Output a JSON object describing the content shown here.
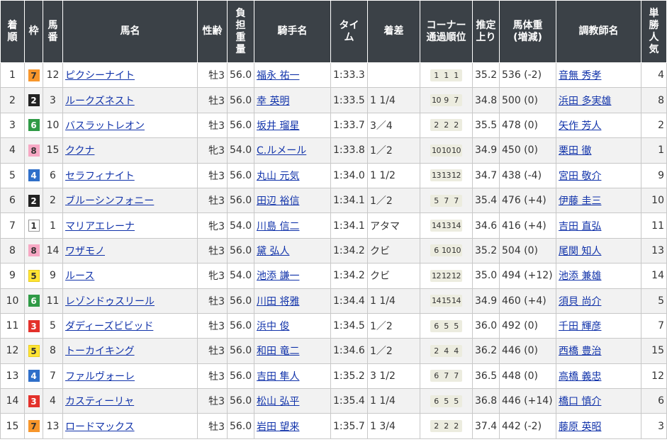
{
  "headers": {
    "rank": "着順",
    "waku": "枠",
    "umaban": "馬番",
    "horse": "馬名",
    "sexage": "性齢",
    "weight": "負担重量",
    "jockey": "騎手名",
    "time": "タイム",
    "margin": "着差",
    "corner": "コーナー通過順位",
    "last": "推定上り",
    "bodyweight": "馬体重(増減)",
    "trainer": "調教師名",
    "pop": "単勝人気"
  },
  "waku_colors": {
    "1": {
      "bg": "#ffffff",
      "fg": "#333333",
      "border": "#999999"
    },
    "2": {
      "bg": "#222222",
      "fg": "#ffffff",
      "border": "#222222"
    },
    "3": {
      "bg": "#e3312b",
      "fg": "#ffffff",
      "border": "#e3312b"
    },
    "4": {
      "bg": "#2f6fc9",
      "fg": "#ffffff",
      "border": "#2f6fc9"
    },
    "5": {
      "bg": "#ffe433",
      "fg": "#333333",
      "border": "#e8cc20"
    },
    "6": {
      "bg": "#2f9a46",
      "fg": "#ffffff",
      "border": "#2f9a46"
    },
    "7": {
      "bg": "#f7962b",
      "fg": "#333333",
      "border": "#f7962b"
    },
    "8": {
      "bg": "#f7a8c4",
      "fg": "#333333",
      "border": "#f7a8c4"
    }
  },
  "rows": [
    {
      "rank": "1",
      "waku": "7",
      "umaban": "12",
      "horse": "ピクシーナイト",
      "sexage": "牡3",
      "weight": "56.0",
      "jockey": "福永 祐一",
      "time": "1:33.3",
      "margin": "",
      "corner": [
        "1",
        "1",
        "1"
      ],
      "last": "35.2",
      "bodyweight": "536 (-2)",
      "trainer": "音無 秀孝",
      "pop": "4"
    },
    {
      "rank": "2",
      "waku": "2",
      "umaban": "3",
      "horse": "ルークズネスト",
      "sexage": "牡3",
      "weight": "56.0",
      "jockey": "幸 英明",
      "time": "1:33.5",
      "margin": "1 1/4",
      "corner": [
        "10",
        "9",
        "7"
      ],
      "last": "34.8",
      "bodyweight": "500 (0)",
      "trainer": "浜田 多実雄",
      "pop": "8"
    },
    {
      "rank": "3",
      "waku": "6",
      "umaban": "10",
      "horse": "バスラットレオン",
      "sexage": "牡3",
      "weight": "56.0",
      "jockey": "坂井 瑠星",
      "time": "1:33.7",
      "margin": "3／4",
      "corner": [
        "2",
        "2",
        "2"
      ],
      "last": "35.5",
      "bodyweight": "478 (0)",
      "trainer": "矢作 芳人",
      "pop": "2"
    },
    {
      "rank": "4",
      "waku": "8",
      "umaban": "15",
      "horse": "ククナ",
      "sexage": "牝3",
      "weight": "54.0",
      "jockey": "C.ルメール",
      "time": "1:33.8",
      "margin": "1／2",
      "corner": [
        "10",
        "10",
        "10"
      ],
      "last": "34.9",
      "bodyweight": "450 (0)",
      "trainer": "栗田 徹",
      "pop": "1"
    },
    {
      "rank": "5",
      "waku": "4",
      "umaban": "6",
      "horse": "セラフィナイト",
      "sexage": "牡3",
      "weight": "56.0",
      "jockey": "丸山 元気",
      "time": "1:34.0",
      "margin": "1 1/2",
      "corner": [
        "13",
        "13",
        "12"
      ],
      "last": "34.7",
      "bodyweight": "438 (-4)",
      "trainer": "宮田 敬介",
      "pop": "9"
    },
    {
      "rank": "6",
      "waku": "2",
      "umaban": "2",
      "horse": "ブルーシンフォニー",
      "sexage": "牡3",
      "weight": "56.0",
      "jockey": "田辺 裕信",
      "time": "1:34.1",
      "margin": "1／2",
      "corner": [
        "5",
        "7",
        "7"
      ],
      "last": "35.4",
      "bodyweight": "476 (+4)",
      "trainer": "伊藤 圭三",
      "pop": "10"
    },
    {
      "rank": "7",
      "waku": "1",
      "umaban": "1",
      "horse": "マリアエレーナ",
      "sexage": "牝3",
      "weight": "54.0",
      "jockey": "川島 信二",
      "time": "1:34.1",
      "margin": "アタマ",
      "corner": [
        "14",
        "13",
        "14"
      ],
      "last": "34.6",
      "bodyweight": "416 (+4)",
      "trainer": "吉田 直弘",
      "pop": "11"
    },
    {
      "rank": "8",
      "waku": "8",
      "umaban": "14",
      "horse": "ワザモノ",
      "sexage": "牡3",
      "weight": "56.0",
      "jockey": "黛 弘人",
      "time": "1:34.2",
      "margin": "クビ",
      "corner": [
        "6",
        "10",
        "10"
      ],
      "last": "35.2",
      "bodyweight": "504 (0)",
      "trainer": "尾関 知人",
      "pop": "13"
    },
    {
      "rank": "9",
      "waku": "5",
      "umaban": "9",
      "horse": "ルース",
      "sexage": "牝3",
      "weight": "54.0",
      "jockey": "池添 謙一",
      "time": "1:34.2",
      "margin": "クビ",
      "corner": [
        "12",
        "12",
        "12"
      ],
      "last": "35.0",
      "bodyweight": "494 (+12)",
      "trainer": "池添 兼雄",
      "pop": "14"
    },
    {
      "rank": "10",
      "waku": "6",
      "umaban": "11",
      "horse": "レゾンドゥスリール",
      "sexage": "牡3",
      "weight": "56.0",
      "jockey": "川田 将雅",
      "time": "1:34.4",
      "margin": "1 1/4",
      "corner": [
        "14",
        "15",
        "14"
      ],
      "last": "34.9",
      "bodyweight": "460 (+4)",
      "trainer": "須貝 尚介",
      "pop": "5"
    },
    {
      "rank": "11",
      "waku": "3",
      "umaban": "5",
      "horse": "ダディーズビビッド",
      "sexage": "牡3",
      "weight": "56.0",
      "jockey": "浜中 俊",
      "time": "1:34.5",
      "margin": "1／2",
      "corner": [
        "6",
        "5",
        "5"
      ],
      "last": "36.0",
      "bodyweight": "492 (0)",
      "trainer": "千田 輝彦",
      "pop": "7"
    },
    {
      "rank": "12",
      "waku": "5",
      "umaban": "8",
      "horse": "トーカイキング",
      "sexage": "牡3",
      "weight": "56.0",
      "jockey": "和田 竜二",
      "time": "1:34.6",
      "margin": "1／2",
      "corner": [
        "2",
        "4",
        "4"
      ],
      "last": "36.2",
      "bodyweight": "446 (0)",
      "trainer": "西橋 豊治",
      "pop": "15"
    },
    {
      "rank": "13",
      "waku": "4",
      "umaban": "7",
      "horse": "ファルヴォーレ",
      "sexage": "牡3",
      "weight": "56.0",
      "jockey": "吉田 隼人",
      "time": "1:35.2",
      "margin": "3 1/2",
      "corner": [
        "6",
        "7",
        "7"
      ],
      "last": "36.5",
      "bodyweight": "448 (0)",
      "trainer": "高橋 義忠",
      "pop": "12"
    },
    {
      "rank": "14",
      "waku": "3",
      "umaban": "4",
      "horse": "カスティーリャ",
      "sexage": "牡3",
      "weight": "56.0",
      "jockey": "松山 弘平",
      "time": "1:35.4",
      "margin": "1 1/4",
      "corner": [
        "6",
        "5",
        "5"
      ],
      "last": "36.8",
      "bodyweight": "446 (+14)",
      "trainer": "橋口 慎介",
      "pop": "6"
    },
    {
      "rank": "15",
      "waku": "7",
      "umaban": "13",
      "horse": "ロードマックス",
      "sexage": "牡3",
      "weight": "56.0",
      "jockey": "岩田 望来",
      "time": "1:35.7",
      "margin": "1 3/4",
      "corner": [
        "2",
        "2",
        "2"
      ],
      "last": "37.4",
      "bodyweight": "442 (-2)",
      "trainer": "藤原 英昭",
      "pop": "3"
    }
  ]
}
